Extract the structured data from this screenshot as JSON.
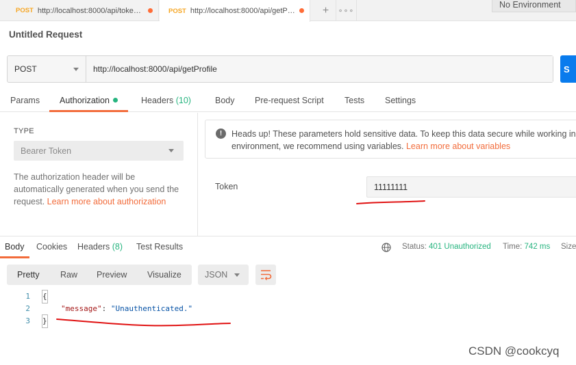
{
  "tabs": [
    {
      "method": "POST",
      "url": "http://localhost:8000/api/toke…"
    },
    {
      "method": "POST",
      "url": "http://localhost:8000/api/getP…"
    }
  ],
  "tab_controls": {
    "new_tab": "+",
    "more": "∘∘∘"
  },
  "environment": "No Environment",
  "request_title": "Untitled Request",
  "request": {
    "method": "POST",
    "url": "http://localhost:8000/api/getProfile",
    "send_label": "S"
  },
  "request_tabs": {
    "params": "Params",
    "authorization": "Authorization",
    "headers": "Headers",
    "headers_count": "(10)",
    "body": "Body",
    "prerequest": "Pre-request Script",
    "tests": "Tests",
    "settings": "Settings"
  },
  "auth": {
    "type_label": "TYPE",
    "type_value": "Bearer Token",
    "description": "The authorization header will be automatically generated when you send the request. ",
    "learn_more": "Learn more about authorization",
    "notice_text_1": "Heads up! These parameters hold sensitive data. To keep this data secure while working in",
    "notice_text_2": "environment, we recommend using variables. ",
    "notice_link": "Learn more about variables",
    "token_label": "Token",
    "token_value": "11111111"
  },
  "response_tabs": {
    "body": "Body",
    "cookies": "Cookies",
    "headers": "Headers",
    "headers_count": "(8)",
    "test_results": "Test Results"
  },
  "status": {
    "status_label": "Status:",
    "status_value": "401 Unauthorized",
    "time_label": "Time:",
    "time_value": "742 ms",
    "size_label": "Size:"
  },
  "response_view": {
    "pretty": "Pretty",
    "raw": "Raw",
    "preview": "Preview",
    "visualize": "Visualize",
    "format": "JSON"
  },
  "code_lines": [
    {
      "n": "1",
      "text": "{"
    },
    {
      "n": "2",
      "key": "\"message\"",
      "sep": ": ",
      "value": "\"Unauthenticated.\""
    },
    {
      "n": "3",
      "text": "}"
    }
  ],
  "colors": {
    "accent": "#f26b3a",
    "send": "#097bed",
    "success": "#26b47f",
    "method": "#f6a623"
  },
  "watermark": "CSDN @cookcyq"
}
